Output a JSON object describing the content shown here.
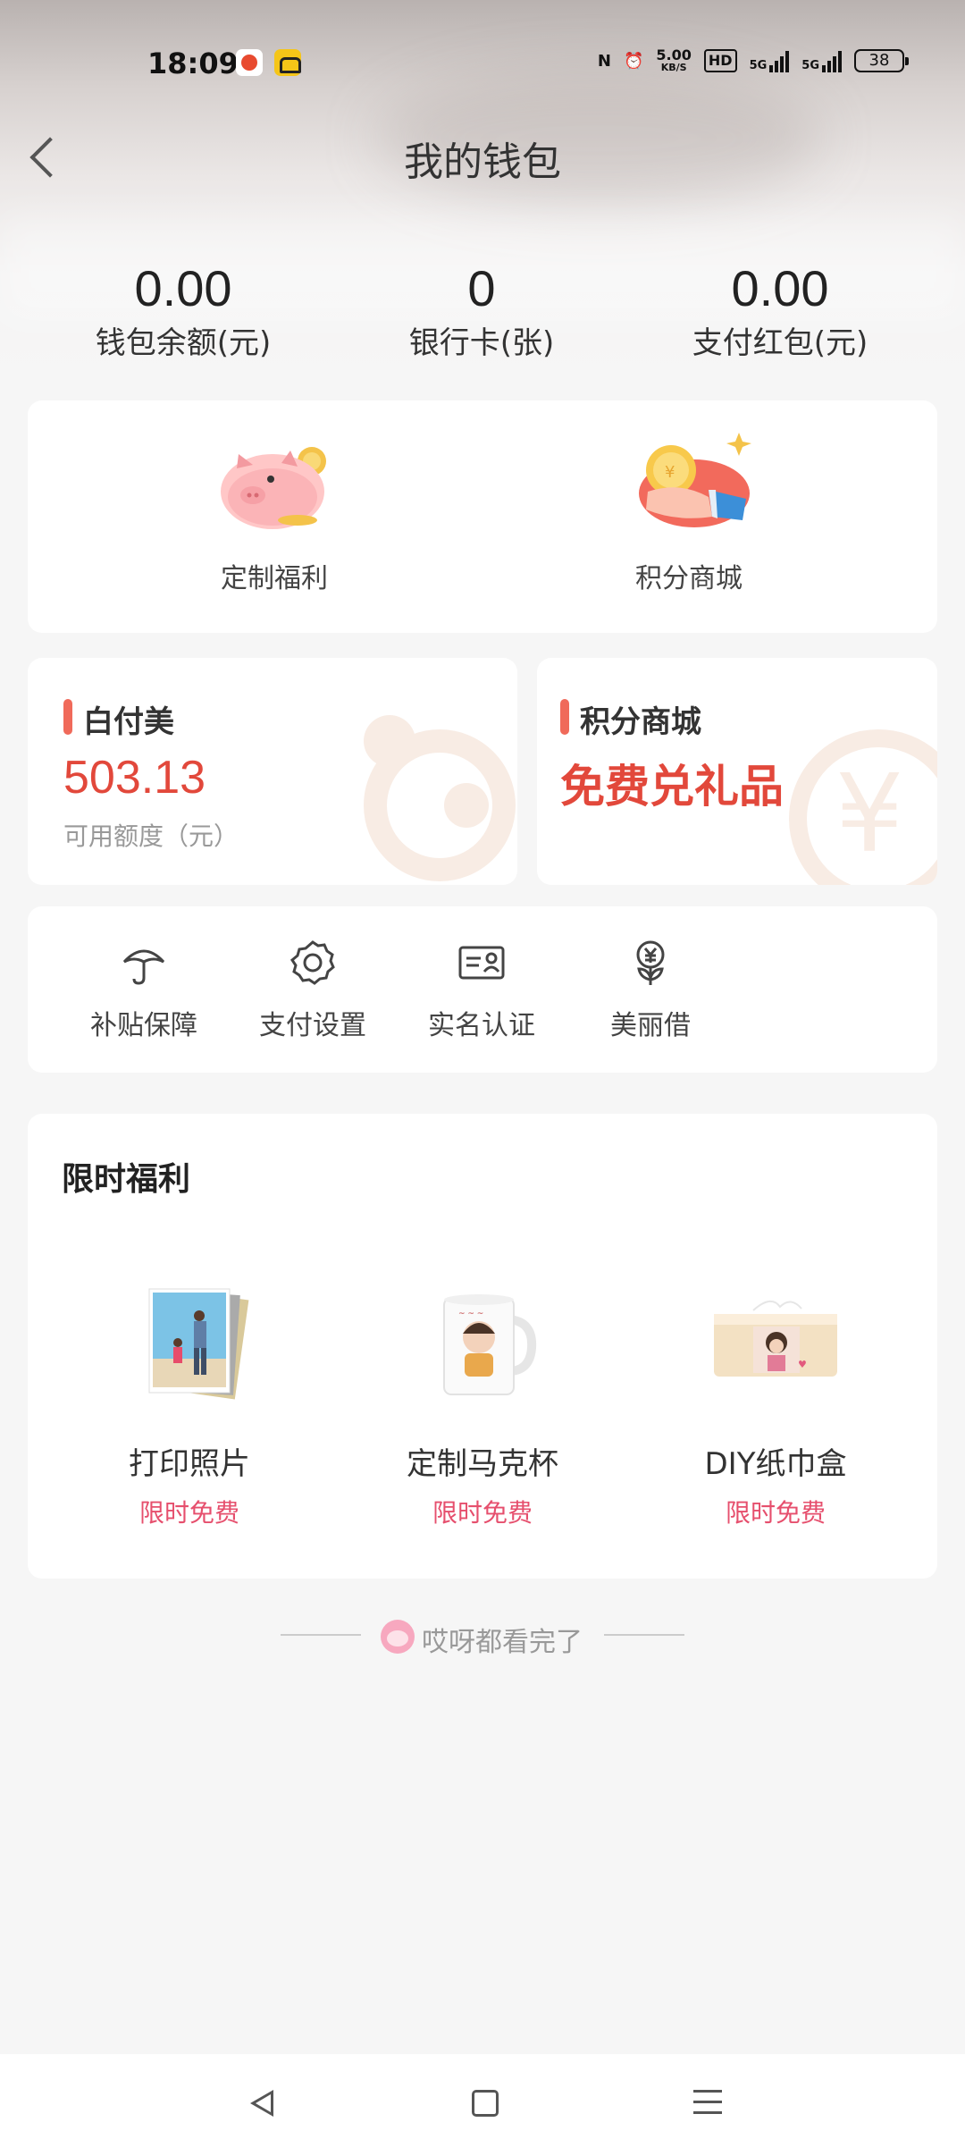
{
  "status_bar": {
    "time": "18:09",
    "net_speed_value": "5.00",
    "net_speed_unit": "KB/S",
    "hd_label": "HD",
    "sim1": "5G",
    "sim2": "5G",
    "battery": "38"
  },
  "header": {
    "title": "我的钱包"
  },
  "stats": [
    {
      "value": "0.00",
      "label": "钱包余额(元)"
    },
    {
      "value": "0",
      "label": "银行卡(张)"
    },
    {
      "value": "0.00",
      "label": "支付红包(元)"
    }
  ],
  "features": [
    {
      "label": "定制福利",
      "icon": "piggy-bank-icon"
    },
    {
      "label": "积分商城",
      "icon": "hand-coin-icon"
    }
  ],
  "baifumei": {
    "title": "白付美",
    "amount": "503.13",
    "sub": "可用额度（元）"
  },
  "points_mall": {
    "title": "积分商城",
    "promo": "免费兑礼品"
  },
  "tools": [
    {
      "label": "补贴保障",
      "icon": "umbrella-icon"
    },
    {
      "label": "支付设置",
      "icon": "gear-icon"
    },
    {
      "label": "实名认证",
      "icon": "id-card-icon"
    },
    {
      "label": "美丽借",
      "icon": "yuan-flower-icon"
    }
  ],
  "limited": {
    "title": "限时福利",
    "products": [
      {
        "name": "打印照片",
        "tag": "限时免费"
      },
      {
        "name": "定制马克杯",
        "tag": "限时免费"
      },
      {
        "name": "DIY纸巾盒",
        "tag": "限时免费"
      }
    ]
  },
  "end_text": "哎呀都看完了",
  "colors": {
    "accent_red": "#e2483b",
    "tag_pink": "#e64f6d",
    "background": "#f6f6f6"
  }
}
